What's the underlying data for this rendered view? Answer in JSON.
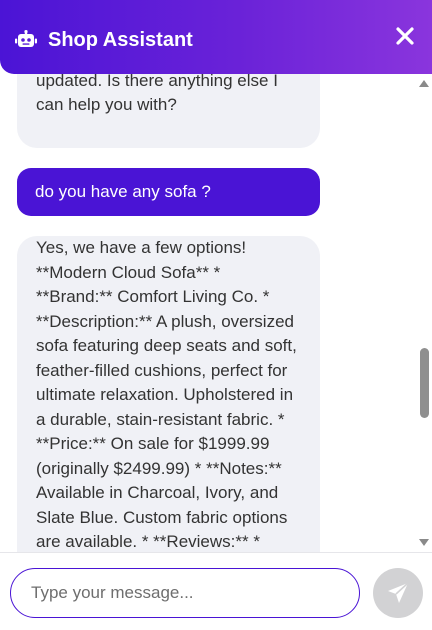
{
  "header": {
    "title": "Shop Assistant",
    "bot_icon": "robot-icon",
    "close_icon": "close-icon"
  },
  "messages": [
    {
      "role": "bot",
      "text": "the inventory is currently being updated. Is there anything else I can help you with?"
    },
    {
      "role": "user",
      "text": "do you have any sofa ?"
    },
    {
      "role": "bot",
      "text": "Yes, we have a few options! **Modern Cloud Sofa** * **Brand:** Comfort Living Co. * **Description:** A plush, oversized sofa featuring deep seats and soft, feather-filled cushions, perfect for ultimate relaxation. Upholstered in a durable, stain-resistant fabric. * **Price:** On sale for $1999.99 (originally $2499.99) * **Notes:** Available in Charcoal, Ivory, and Slate Blue. Custom fabric options are available. * **Reviews:** *"
    }
  ],
  "composer": {
    "placeholder": "Type your message...",
    "value": "",
    "send_icon": "send-icon"
  },
  "colors": {
    "accent": "#4a14d5",
    "header_end": "#8a35dd",
    "bot_bubble": "#f0f1f6",
    "send_button": "#d2d2d4"
  }
}
